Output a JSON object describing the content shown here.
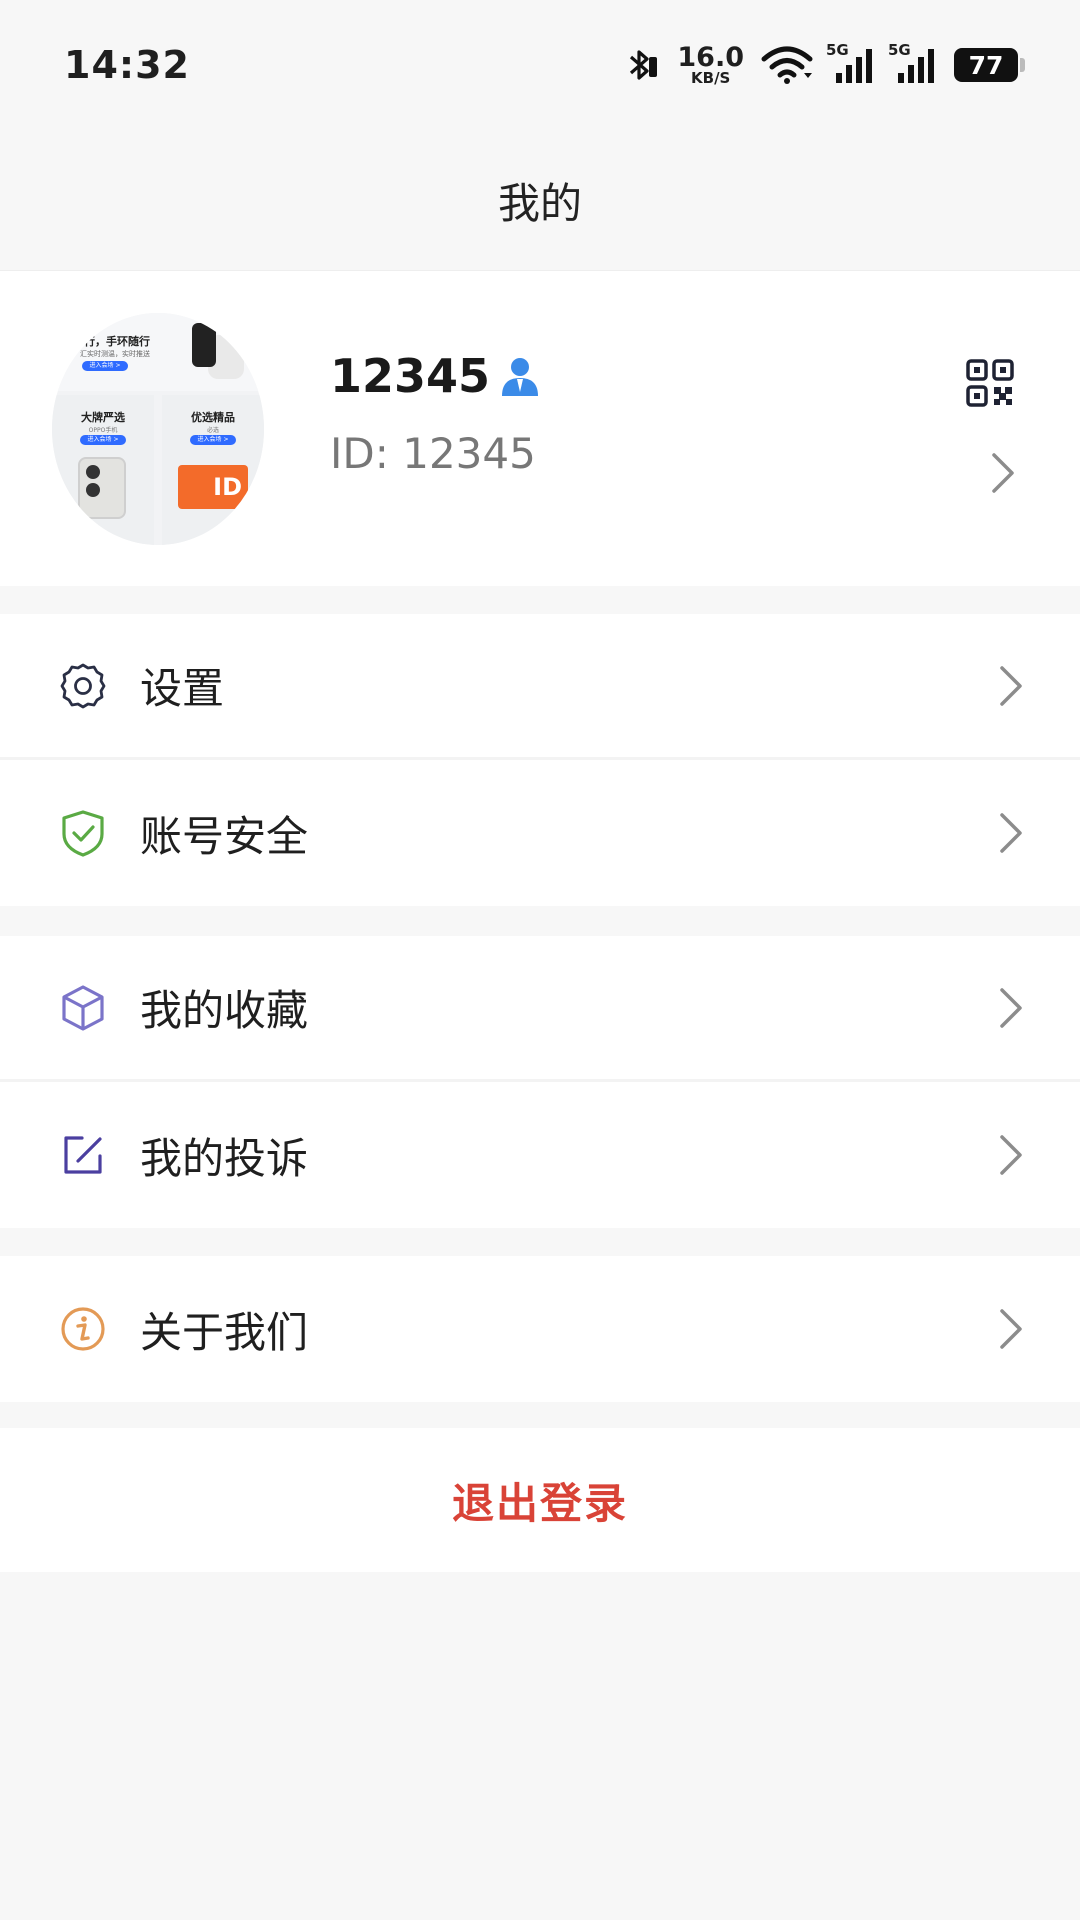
{
  "status_bar": {
    "time": "14:32",
    "net_speed_value": "16.0",
    "net_speed_unit": "KB/S",
    "signal_1_tag": "5G",
    "signal_2_tag": "5G",
    "battery": "77"
  },
  "header": {
    "title": "我的"
  },
  "profile": {
    "username": "12345",
    "user_id": "ID: 12345",
    "avatar_texts": {
      "top_title": "行，手环随行",
      "top_sub": "汇实时测温，实时推送",
      "top_pill": "进入会场 >",
      "left_title": "大牌严选",
      "left_sub": "OPPO手机",
      "left_pill": "进入会场 >",
      "right_title": "优选精品",
      "right_sub": "必选",
      "right_pill": "进入会场 >",
      "card_text": "ID"
    }
  },
  "menu": {
    "group1": [
      {
        "label": "设置",
        "icon": "gear-icon"
      },
      {
        "label": "账号安全",
        "icon": "shield-check-icon"
      }
    ],
    "group2": [
      {
        "label": "我的收藏",
        "icon": "cube-icon"
      },
      {
        "label": "我的投诉",
        "icon": "edit-icon"
      }
    ],
    "group3": [
      {
        "label": "关于我们",
        "icon": "info-icon"
      }
    ]
  },
  "logout": {
    "label": "退出登录"
  },
  "colors": {
    "logout_red": "#d94337",
    "shield_green": "#5aaa44",
    "cube_purple": "#7b74c9",
    "edit_purple": "#4b3fa0",
    "info_orange": "#e39a56",
    "user_badge_blue": "#3b8be8"
  }
}
